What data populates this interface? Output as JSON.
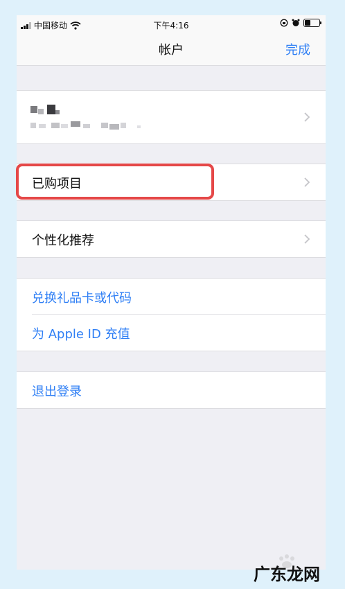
{
  "status_bar": {
    "carrier": "中国移动",
    "time": "下午4:16"
  },
  "nav": {
    "title": "帐户",
    "done_label": "完成"
  },
  "list": {
    "purchased": "已购项目",
    "personalized": "个性化推荐",
    "redeem": "兑换礼品卡或代码",
    "add_funds": "为 Apple ID 充值",
    "sign_out": "退出登录"
  },
  "watermark": "广东龙网",
  "colors": {
    "link": "#2f7ff5",
    "highlight": "#e54848",
    "frame": "#dff1fb"
  }
}
